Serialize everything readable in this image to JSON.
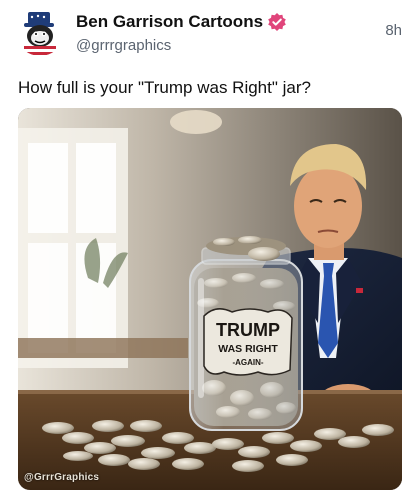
{
  "post": {
    "author_name": "Ben Garrison Cartoons",
    "handle": "@grrrgraphics",
    "time": "8h",
    "text": "How full is your \"Trump was Right\" jar?",
    "verified_icon": "verified-badge-icon",
    "accent_color": "#e0457b"
  },
  "image": {
    "jar_label_line1": "TRUMP",
    "jar_label_line2": "WAS RIGHT",
    "jar_label_line3": "-AGAIN-",
    "watermark": "@GrrrGraphics"
  }
}
